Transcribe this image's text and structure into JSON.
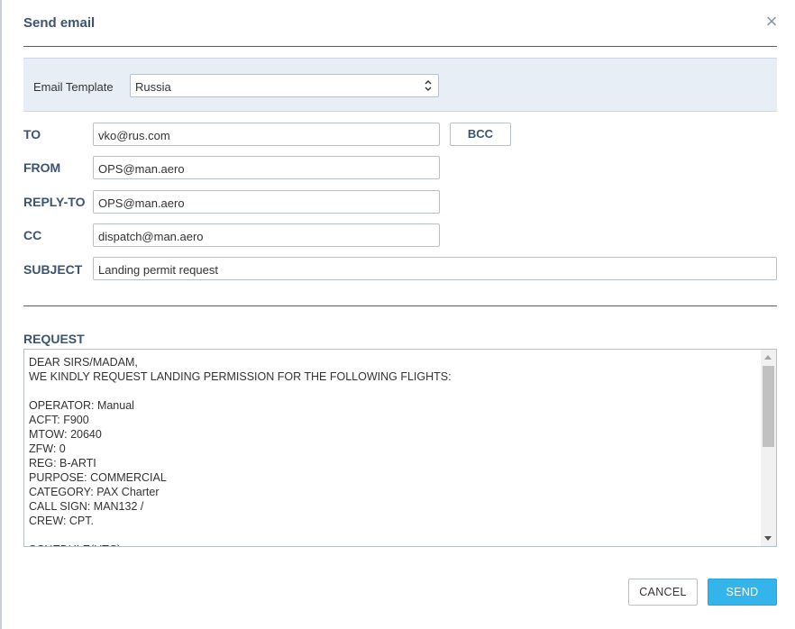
{
  "dialog": {
    "title": "Send email",
    "close_symbol": "×"
  },
  "template": {
    "label": "Email Template",
    "selected": "Russia"
  },
  "fields": {
    "to_label": "TO",
    "to_value": "vko@rus.com",
    "bcc_label": "BCC",
    "from_label": "FROM",
    "from_value": "OPS@man.aero",
    "reply_to_label": "REPLY-TO",
    "reply_to_value": "OPS@man.aero",
    "cc_label": "CC",
    "cc_value": "dispatch@man.aero",
    "subject_label": "SUBJECT",
    "subject_value": "Landing permit request"
  },
  "request": {
    "label": "REQUEST",
    "body": "DEAR SIRS/MADAM,\nWE KINDLY REQUEST LANDING PERMISSION FOR THE FOLLOWING FLIGHTS:\n\nOPERATOR: Manual\nACFT: F900\nMTOW: 20640\nZFW: 0\nREG: B-ARTI\nPURPOSE: COMMERCIAL\nCATEGORY: PAX Charter\nCALL SIGN: MAN132 /\nCREW: CPT.\n\nSCHEDULE(UTC):"
  },
  "footer": {
    "cancel_label": "CANCEL",
    "send_label": "SEND"
  },
  "colors": {
    "heading": "#3d5370",
    "send_button": "#33b5ec",
    "template_bar": "#e8eef6"
  }
}
